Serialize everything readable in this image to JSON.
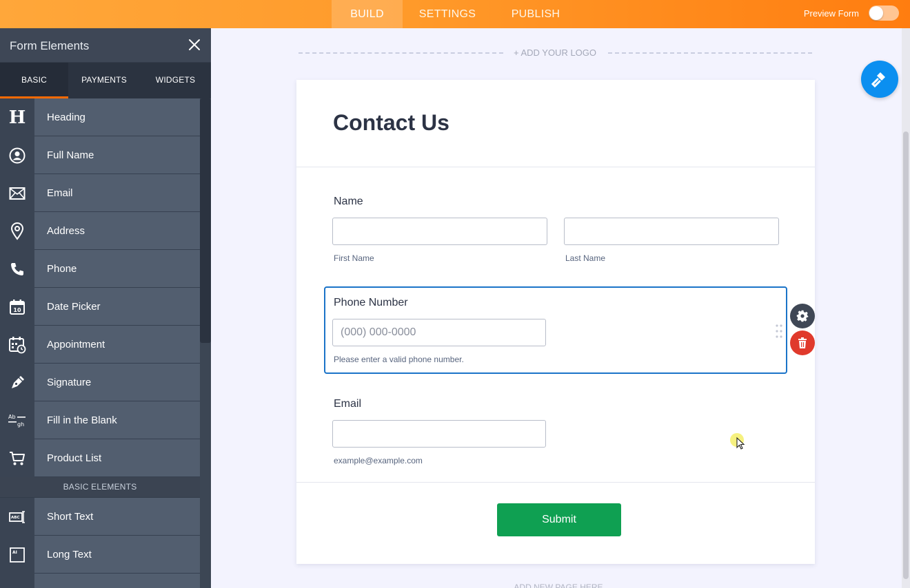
{
  "topbar": {
    "tabs": [
      "BUILD",
      "SETTINGS",
      "PUBLISH"
    ],
    "active_tab": "BUILD",
    "preview_label": "Preview Form",
    "preview_on": false
  },
  "sidebar": {
    "title": "Form Elements",
    "tabs": [
      "BASIC",
      "PAYMENTS",
      "WIDGETS"
    ],
    "active_tab": "BASIC",
    "items": [
      {
        "label": "Heading",
        "icon": "heading-icon"
      },
      {
        "label": "Full Name",
        "icon": "user-icon"
      },
      {
        "label": "Email",
        "icon": "envelope-icon"
      },
      {
        "label": "Address",
        "icon": "location-pin-icon"
      },
      {
        "label": "Phone",
        "icon": "phone-icon"
      },
      {
        "label": "Date Picker",
        "icon": "calendar-icon"
      },
      {
        "label": "Appointment",
        "icon": "appointment-icon"
      },
      {
        "label": "Signature",
        "icon": "pen-icon"
      },
      {
        "label": "Fill in the Blank",
        "icon": "fill-blank-icon"
      },
      {
        "label": "Product List",
        "icon": "cart-icon"
      }
    ],
    "section_label": "BASIC ELEMENTS",
    "basic_items": [
      {
        "label": "Short Text",
        "icon": "short-text-icon"
      },
      {
        "label": "Long Text",
        "icon": "long-text-icon"
      }
    ]
  },
  "canvas": {
    "logo_text": "+ ADD YOUR LOGO",
    "add_page_text": "ADD NEW PAGE HERE"
  },
  "form": {
    "title": "Contact Us",
    "name_label": "Name",
    "first_name_sublabel": "First Name",
    "last_name_sublabel": "Last Name",
    "phone_label": "Phone Number",
    "phone_placeholder": "(000) 000-0000",
    "phone_sublabel": "Please enter a valid phone number.",
    "email_label": "Email",
    "email_sublabel": "example@example.com",
    "submit_label": "Submit"
  },
  "colors": {
    "accent_orange": "#ff8a1f",
    "selection_blue": "#1a73c8",
    "submit_green": "#0fa052",
    "delete_red": "#e03a2c"
  }
}
